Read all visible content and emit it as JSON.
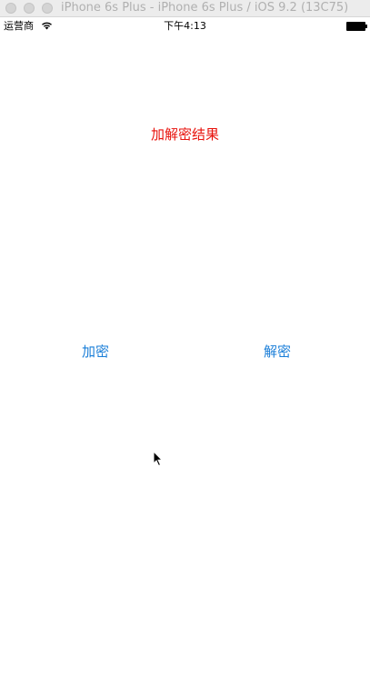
{
  "window": {
    "title": "iPhone 6s Plus - iPhone 6s Plus / iOS 9.2 (13C75)"
  },
  "status_bar": {
    "carrier": "运营商",
    "time": "下午4:13",
    "wifi_icon": "wifi-icon",
    "battery_icon": "battery-icon"
  },
  "main": {
    "result_label": "加解密结果",
    "encrypt_button": "加密",
    "decrypt_button": "解密"
  },
  "colors": {
    "result_text": "#e8120c",
    "button_text": "#1a7ed8"
  }
}
